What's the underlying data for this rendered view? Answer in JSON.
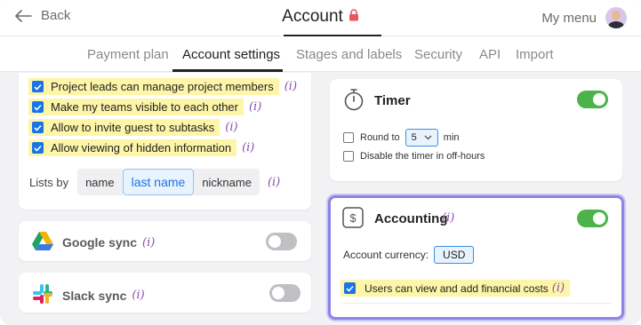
{
  "header": {
    "back_label": "Back",
    "title": "Account",
    "my_menu_label": "My menu"
  },
  "tabs": [
    {
      "label": "Payment plan"
    },
    {
      "label": "Account settings"
    },
    {
      "label": "Stages and labels"
    },
    {
      "label": "Security"
    },
    {
      "label": "API"
    },
    {
      "label": "Import"
    }
  ],
  "permissions": {
    "items": [
      {
        "label": "Project leads can manage project members",
        "checked": true,
        "info": "(i)"
      },
      {
        "label": "Make my teams visible to each other",
        "checked": true,
        "info": "(i)"
      },
      {
        "label": "Allow to invite guest to subtasks",
        "checked": true,
        "info": "(i)"
      },
      {
        "label": "Allow viewing of hidden information",
        "checked": true,
        "info": "(i)"
      }
    ],
    "lists_by_label": "Lists by",
    "lists_by_options": [
      "name",
      "last name",
      "nickname"
    ],
    "lists_by_selected": "last name",
    "lists_by_info": "(i)"
  },
  "google_sync": {
    "label": "Google sync",
    "info": "(i)",
    "enabled": false
  },
  "slack_sync": {
    "label": "Slack sync",
    "info": "(i)",
    "enabled": false
  },
  "timer": {
    "title": "Timer",
    "enabled": true,
    "round_to_label": "Round to",
    "round_to_value": "5",
    "round_to_unit": "min",
    "round_to_checked": false,
    "disable_off_hours_label": "Disable the timer in off-hours",
    "disable_off_hours_checked": false
  },
  "accounting": {
    "title": "Accounting",
    "info": "(i)",
    "enabled": true,
    "currency_label": "Account currency:",
    "currency_value": "USD",
    "financial_label": "Users can view and add financial costs",
    "financial_info": "(i)",
    "financial_checked": true
  },
  "colors": {
    "accent_blue": "#1a73e8",
    "toggle_on": "#4cb34b",
    "highlight": "#fdf5a8",
    "info_purple": "#8a4fb0",
    "focus_border": "#8b85e4"
  }
}
